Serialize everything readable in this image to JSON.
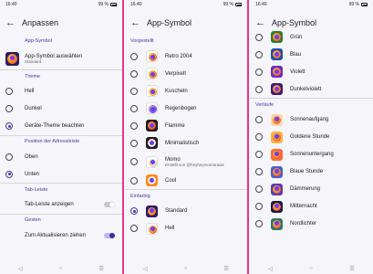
{
  "status": {
    "time": "16:40",
    "battery": "99 %"
  },
  "nav": {
    "back": "◁",
    "home": "○",
    "recents": "☰"
  },
  "screen1": {
    "title": "Anpassen",
    "sections": {
      "app_icon": "App-Symbol",
      "theme": "Theme",
      "address_bar": "Position der Adressleiste",
      "tab_bar": "Tab-Leiste",
      "gestures": "Gesten"
    },
    "app_icon_row": {
      "label": "App-Symbol auswählen",
      "sub": "Standard"
    },
    "theme_options": [
      "Hell",
      "Dunkel",
      "Geräte-Theme beachten"
    ],
    "theme_selected": 2,
    "address_options": [
      "Oben",
      "Unten"
    ],
    "address_selected": 1,
    "tab_bar_row": "Tab-Leiste anzeigen",
    "tab_bar_on": false,
    "pull_refresh_row": "Zum Aktualisieren ziehen",
    "pull_refresh_on": true
  },
  "screen2": {
    "title": "App-Symbol",
    "section_default": "Vorgestellt",
    "items": [
      {
        "label": "Retro 2004",
        "bg": "#ffffff",
        "fox": "#ff7a1a"
      },
      {
        "label": "Verpixelt",
        "bg": "#ffffff",
        "fox": "#ff8c1a"
      },
      {
        "label": "Kuscheln",
        "bg": "#ffffff",
        "fox": "#ffb13c"
      },
      {
        "label": "Regenbogen",
        "bg": "#ffffff",
        "fox": "#7b4dff"
      },
      {
        "label": "Flamme",
        "bg": "#1c1b22",
        "fox": "#ff5a1a"
      },
      {
        "label": "Minimalistisch",
        "bg": "#1c1b22",
        "fox": "#ffffff"
      },
      {
        "label": "Momo",
        "sub": "Erstellt von @heyheymomoraws",
        "bg": "#ffffff",
        "fox": "#e5e0d8"
      },
      {
        "label": "Cool",
        "bg": "#ff8a1a",
        "fox": "#ffffff"
      }
    ],
    "section_single": "Einfarbig",
    "single_items": [
      {
        "label": "Standard",
        "bg": "#2a1a66",
        "fox": "#ff7a1a",
        "selected": true
      },
      {
        "label": "Hell",
        "bg": "#ffffff",
        "fox": "#ff7a1a",
        "selected": false
      }
    ]
  },
  "screen3": {
    "title": "App-Symbol",
    "items": [
      {
        "label": "Grün",
        "bg": "#2e7d32"
      },
      {
        "label": "Blau",
        "bg": "#1e4fb0"
      },
      {
        "label": "Violett",
        "bg": "#6a2cc9"
      },
      {
        "label": "Dunkelviolett",
        "bg": "#3a1a7a"
      }
    ],
    "section_gradients": "Verläufe",
    "gradient_items": [
      {
        "label": "Sonnenaufgang",
        "bg": "#ffd7a8"
      },
      {
        "label": "Goldene Stunde",
        "bg": "#ffb347"
      },
      {
        "label": "Sonnenuntergang",
        "bg": "#ff6a3c"
      },
      {
        "label": "Blaue Stunde",
        "bg": "#4a5fd0"
      },
      {
        "label": "Dämmerung",
        "bg": "#5a3cb0"
      },
      {
        "label": "Mitternacht",
        "bg": "#1a1a4a"
      },
      {
        "label": "Nordlichter",
        "bg": "#2a7a6a"
      }
    ]
  }
}
